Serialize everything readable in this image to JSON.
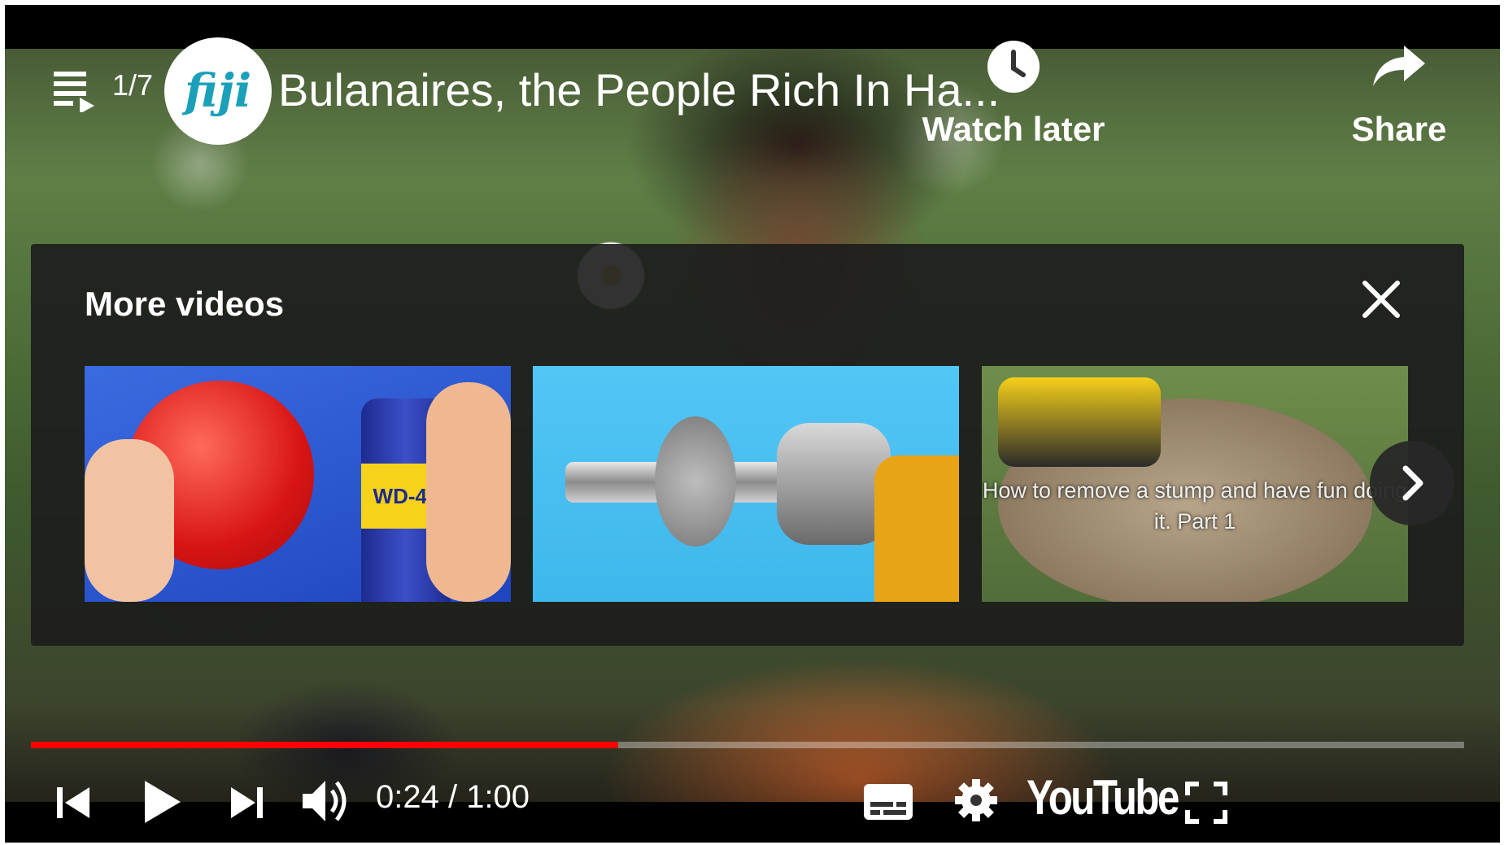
{
  "video": {
    "title": "Bulanaires, the People Rich In Ha...",
    "playlist_position": "1/7",
    "channel_logo_text": "fiji",
    "current_time": "0:24",
    "duration": "1:00",
    "time_display": "0:24 / 1:00",
    "progress_fraction": 0.41
  },
  "actions": {
    "watch_later_label": "Watch later",
    "share_label": "Share"
  },
  "more_videos": {
    "title": "More videos",
    "items": [
      {
        "caption": "",
        "badge_text": "WD-40"
      },
      {
        "caption": ""
      },
      {
        "caption": "How to remove a stump and have fun doing it. Part 1"
      }
    ]
  },
  "brand": {
    "logo_text": "YouTube",
    "accent_color": "#ff0000"
  }
}
